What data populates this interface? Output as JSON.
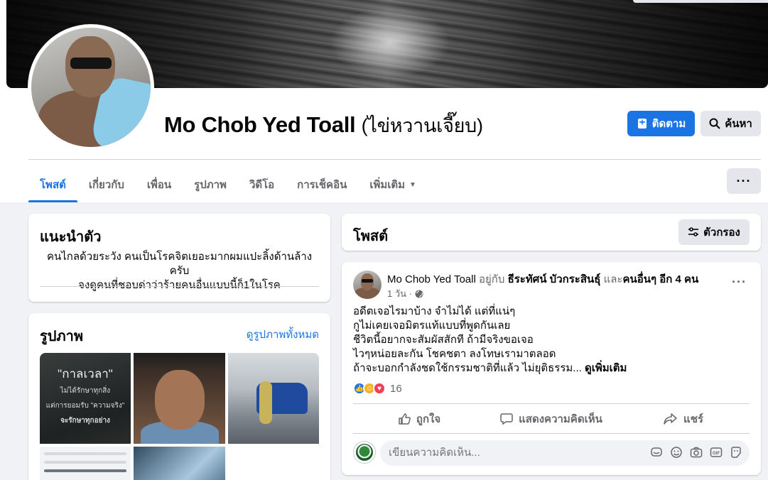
{
  "profile": {
    "name": "Mo Chob Yed Toall",
    "alternate_name": "(ไข่หวานเจี๊ยบ)"
  },
  "header_buttons": {
    "follow": "ติดตาม",
    "search": "ค้นหา"
  },
  "tabs": [
    {
      "label": "โพสต์",
      "active": true
    },
    {
      "label": "เกี่ยวกับ",
      "active": false
    },
    {
      "label": "เพื่อน",
      "active": false
    },
    {
      "label": "รูปภาพ",
      "active": false
    },
    {
      "label": "วิดีโอ",
      "active": false
    },
    {
      "label": "การเช็คอิน",
      "active": false
    },
    {
      "label": "เพิ่มเติม",
      "active": false
    }
  ],
  "intro": {
    "title": "แนะนำตัว",
    "bio_line1": "คนไกลด้วยระวัง คนเป็นโรคจิตเยอะมากผมแปะลิ้งด้านล้างครับ",
    "bio_line2": "จงดูคนที่ชอบด่าว่าร้ายคนอื่นแบบนี้ก็1ในโรค"
  },
  "photos": {
    "title": "รูปภาพ",
    "see_all": "ดูรูปภาพทั้งหมด",
    "photo1_line1": "\"กาลเวลา\"",
    "photo1_line2": "ไม่ได้รักษาทุกสิ่ง",
    "photo1_line3": "แต่การยอมรับ \"ความจริง\"",
    "photo1_line4": "จะรักษาทุกอย่าง"
  },
  "posts_header": {
    "title": "โพสต์",
    "filter": "ตัวกรอง"
  },
  "post": {
    "author": "Mo Chob Yed Toall",
    "with_text": "อยู่กับ",
    "tagged": "ธีระทัศน์ บัวกระสินธุ์",
    "and_text": "และ",
    "others": "คนอื่นๆ อีก 4 คน",
    "time": "1 วัน ·",
    "lines": [
      "อดีตเจอไรมาบ้าง จำไม่ได้ แต่ที่แน่ๆ",
      "กูไม่เคยเจอมิตรแท้แบบที่พูดกันเลย",
      "ชีวิตนี้อยากจะสัมผัสสักที ถ้ามีจริงขอเจอ",
      "ไวๆหน่อยละกัน โชคชตา ลงโทษเรามาตลอด",
      "ถ้าจะบอกกำลังชดใช้กรรมชาติที่แล้ว ไม่ยุติธรรม..."
    ],
    "see_more": "ดูเพิ่มเติม",
    "reaction_count": "16",
    "actions": {
      "like": "ถูกใจ",
      "comment": "แสดงความคิดเห็น",
      "share": "แชร์"
    },
    "comment_placeholder": "เขียนความคิดเห็น..."
  },
  "colors": {
    "accent": "#1b74e4",
    "page_bg": "#f0f2f5",
    "secondary_btn": "#e4e6eb",
    "muted_text": "#65676b"
  },
  "icons": [
    "follow-icon",
    "search-icon",
    "caret-down-icon",
    "more-icon",
    "filter-icon",
    "globe-icon",
    "like-icon",
    "comment-icon",
    "share-icon",
    "sticker-icon",
    "emoji-icon",
    "camera-icon",
    "gif-icon",
    "avatar-sticker-icon"
  ]
}
